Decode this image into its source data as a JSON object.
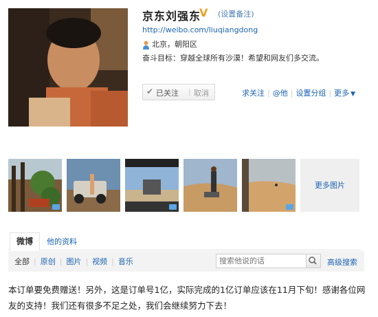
{
  "profile": {
    "name": "京东刘强东",
    "remark": "(设置备注)",
    "url": "http://weibo.com/liuqiangdong",
    "location": "北京，朝阳区",
    "bio": "奋斗目标：穿越全球所有沙漠！希望和网友们多交流。",
    "verified_icon": "verified-v-icon"
  },
  "follow": {
    "followed_label": "已关注",
    "cancel_label": "取消"
  },
  "actions": {
    "ask_follow": "求关注",
    "at": "@他",
    "group": "设置分组",
    "more": "更多"
  },
  "photos": {
    "more_label": "更多图片"
  },
  "tabs": {
    "weibo": "微博",
    "info": "他的资料"
  },
  "filters": {
    "all": "全部",
    "original": "原创",
    "images": "图片",
    "video": "视频",
    "music": "音乐"
  },
  "search": {
    "placeholder": "搜索他说的话",
    "advanced": "高级搜索"
  },
  "post": {
    "text": "本订单要免费赠送！另外，这是订单号1亿，实际完成的1亿订单应该在11月下旬！感谢各位网友的支持！我们还有很多不足之处，我们会继续努力下去！"
  },
  "colors": {
    "link": "#1c64b4",
    "verified": "#f0a020"
  }
}
